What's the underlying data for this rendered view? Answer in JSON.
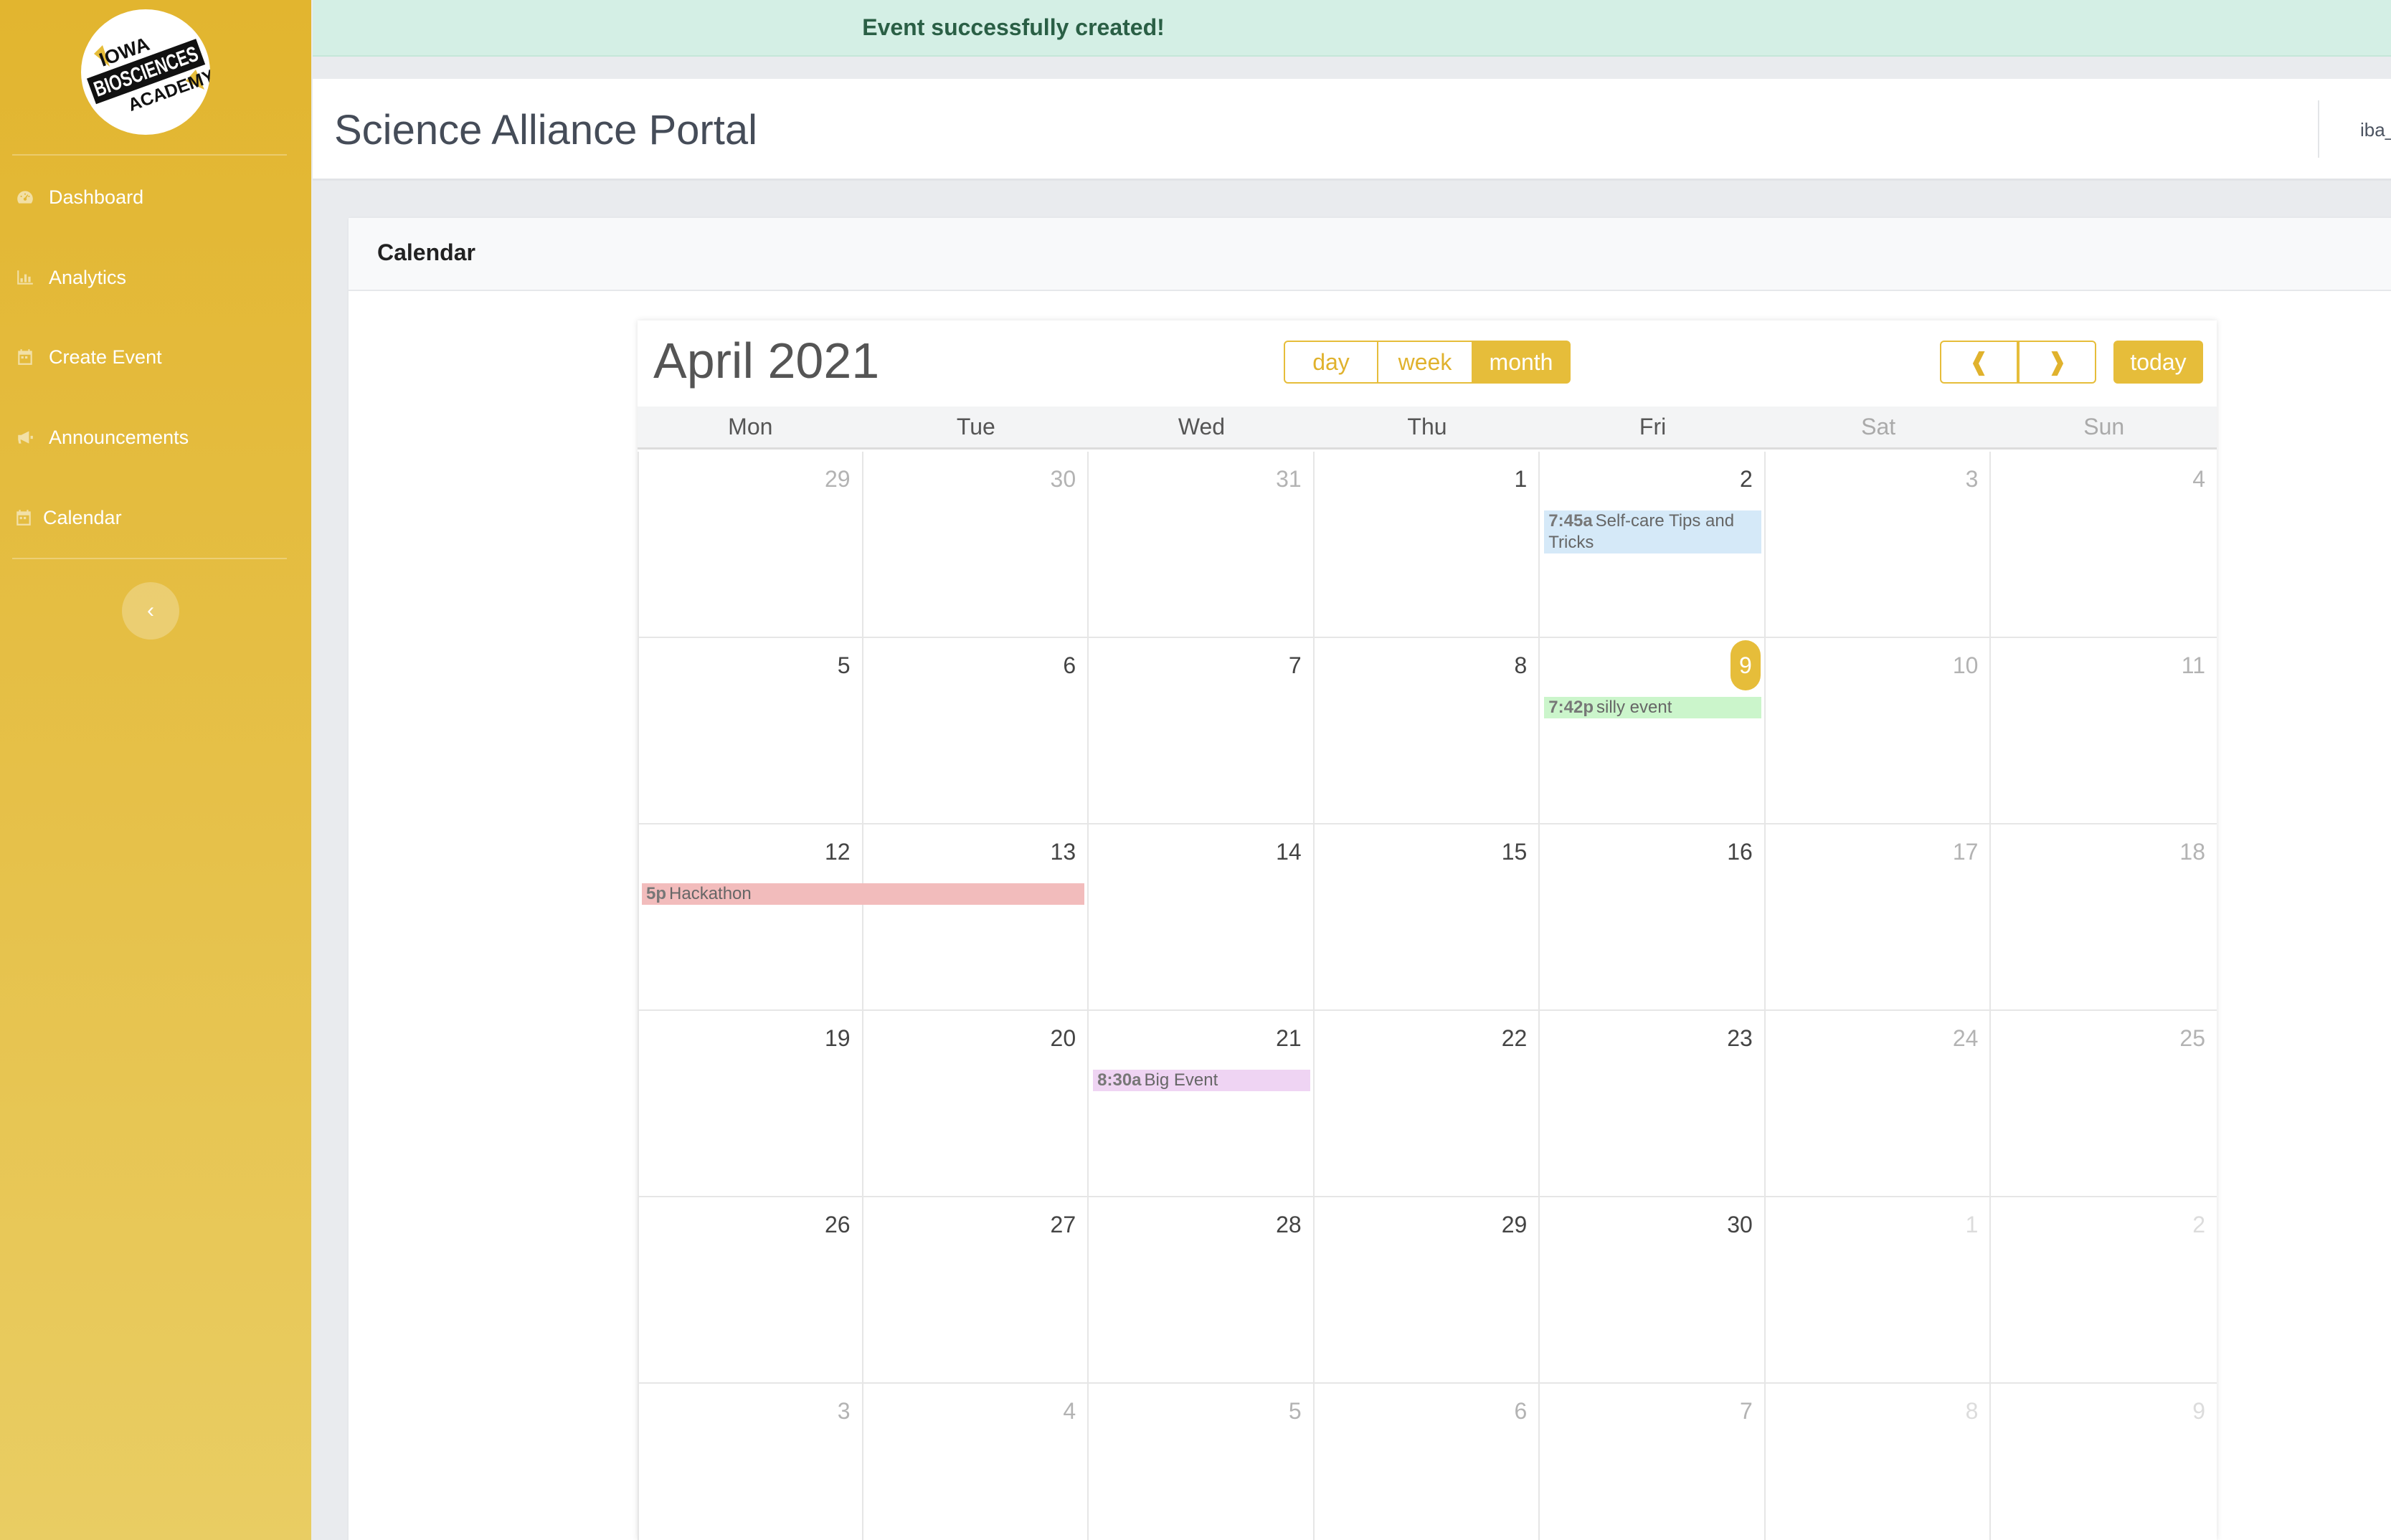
{
  "alert": {
    "message": "Event successfully created!"
  },
  "sidebar": {
    "logo": {
      "lines": [
        "IOWA",
        "BIOSCIENCES",
        "ACADEMY"
      ]
    },
    "items": [
      {
        "label": "Dashboard",
        "icon": "dashboard-icon"
      },
      {
        "label": "Analytics",
        "icon": "chart-icon"
      },
      {
        "label": "Create Event",
        "icon": "calendar-icon"
      },
      {
        "label": "Announcements",
        "icon": "megaphone-icon"
      },
      {
        "label": "Calendar",
        "icon": "calendar-icon"
      }
    ],
    "collapse_glyph": "‹"
  },
  "header": {
    "title": "Science Alliance Portal",
    "user": "iba_"
  },
  "card": {
    "title": "Calendar"
  },
  "calendar": {
    "month_title": "April 2021",
    "views": [
      "day",
      "week",
      "month"
    ],
    "active_view": "month",
    "prev_glyph": "❰",
    "next_glyph": "❱",
    "today_label": "today",
    "weekdays": [
      "Mon",
      "Tue",
      "Wed",
      "Thu",
      "Fri",
      "Sat",
      "Sun"
    ],
    "weeks": [
      [
        {
          "d": "29",
          "m": true
        },
        {
          "d": "30",
          "m": true
        },
        {
          "d": "31",
          "m": true
        },
        {
          "d": "1"
        },
        {
          "d": "2"
        },
        {
          "d": "3",
          "m": true
        },
        {
          "d": "4",
          "m": true
        }
      ],
      [
        {
          "d": "5"
        },
        {
          "d": "6"
        },
        {
          "d": "7"
        },
        {
          "d": "8"
        },
        {
          "d": "9",
          "today": true
        },
        {
          "d": "10",
          "m": true
        },
        {
          "d": "11",
          "m": true
        }
      ],
      [
        {
          "d": "12"
        },
        {
          "d": "13"
        },
        {
          "d": "14"
        },
        {
          "d": "15"
        },
        {
          "d": "16"
        },
        {
          "d": "17",
          "m": true
        },
        {
          "d": "18",
          "m": true
        }
      ],
      [
        {
          "d": "19"
        },
        {
          "d": "20"
        },
        {
          "d": "21"
        },
        {
          "d": "22"
        },
        {
          "d": "23"
        },
        {
          "d": "24",
          "m": true
        },
        {
          "d": "25",
          "m": true
        }
      ],
      [
        {
          "d": "26"
        },
        {
          "d": "27"
        },
        {
          "d": "28"
        },
        {
          "d": "29"
        },
        {
          "d": "30"
        },
        {
          "d": "1",
          "f": true
        },
        {
          "d": "2",
          "f": true
        }
      ],
      [
        {
          "d": "3",
          "m": true
        },
        {
          "d": "4",
          "m": true
        },
        {
          "d": "5",
          "m": true
        },
        {
          "d": "6",
          "m": true
        },
        {
          "d": "7",
          "m": true
        },
        {
          "d": "8",
          "f": true
        },
        {
          "d": "9",
          "f": true
        }
      ]
    ],
    "events": [
      {
        "time": "7:45a",
        "title": "Self-care Tips and Tricks",
        "color": "#d5e9f8",
        "week": 0,
        "day": 4,
        "span": 1,
        "lines": 2
      },
      {
        "time": "7:42p",
        "title": "silly event",
        "color": "#cbf5cb",
        "week": 1,
        "day": 4,
        "span": 1,
        "lines": 1
      },
      {
        "time": "5p",
        "title": "Hackathon",
        "color": "#f2bcbc",
        "week": 2,
        "day": 0,
        "span": 2,
        "lines": 1
      },
      {
        "time": "8:30a",
        "title": "Big Event",
        "color": "#efd4f3",
        "week": 3,
        "day": 2,
        "span": 1,
        "lines": 1
      }
    ],
    "accent": "#e6bd3a"
  }
}
